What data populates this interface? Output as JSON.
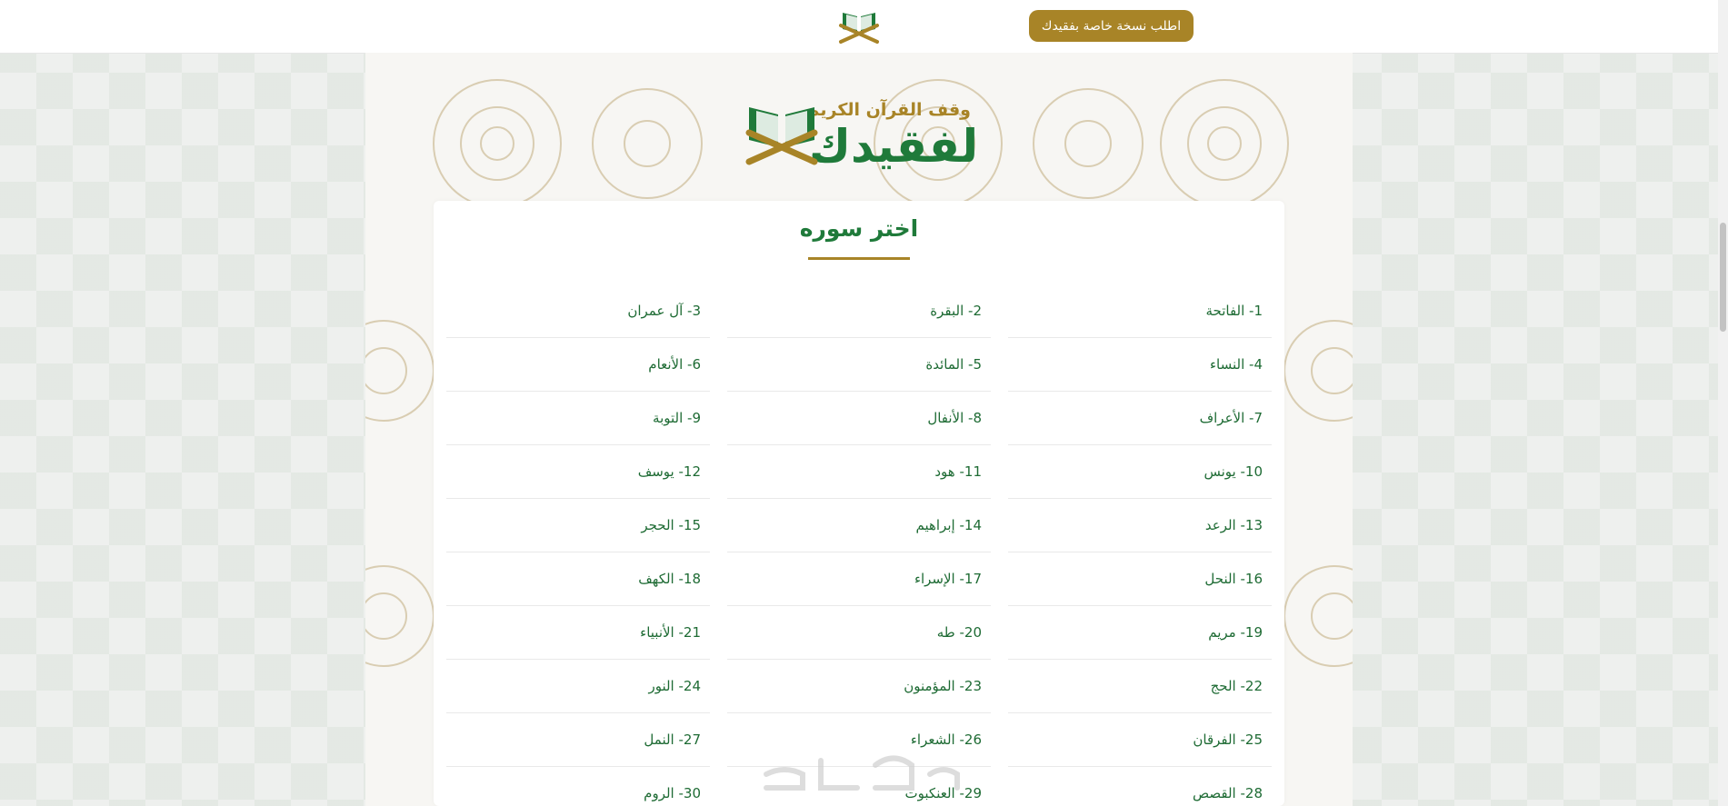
{
  "header": {
    "order_button": "اطلب نسخة خاصة بفقيدك",
    "logo_icon": "quran-stand-icon"
  },
  "brand": {
    "subtitle": "وقف القرآن الكريم",
    "title": "لفقيدك",
    "icon": "quran-stand-icon"
  },
  "card": {
    "title": "اختر سوره"
  },
  "surahs": [
    "1- الفاتحة",
    "2- البقرة",
    "3- آل عمران",
    "4- النساء",
    "5- المائدة",
    "6- الأنعام",
    "7- الأعراف",
    "8- الأنفال",
    "9- التوبة",
    "10- يونس",
    "11- هود",
    "12- يوسف",
    "13- الرعد",
    "14- إبراهيم",
    "15- الحجر",
    "16- النحل",
    "17- الإسراء",
    "18- الكهف",
    "19- مريم",
    "20- طه",
    "21- الأنبياء",
    "22- الحج",
    "23- المؤمنون",
    "24- النور",
    "25- الفرقان",
    "26- الشعراء",
    "27- النمل",
    "28- القصص",
    "29- العنكبوت",
    "30- الروم"
  ],
  "colors": {
    "primary_green": "#1f7a3a",
    "gold": "#a88427"
  }
}
